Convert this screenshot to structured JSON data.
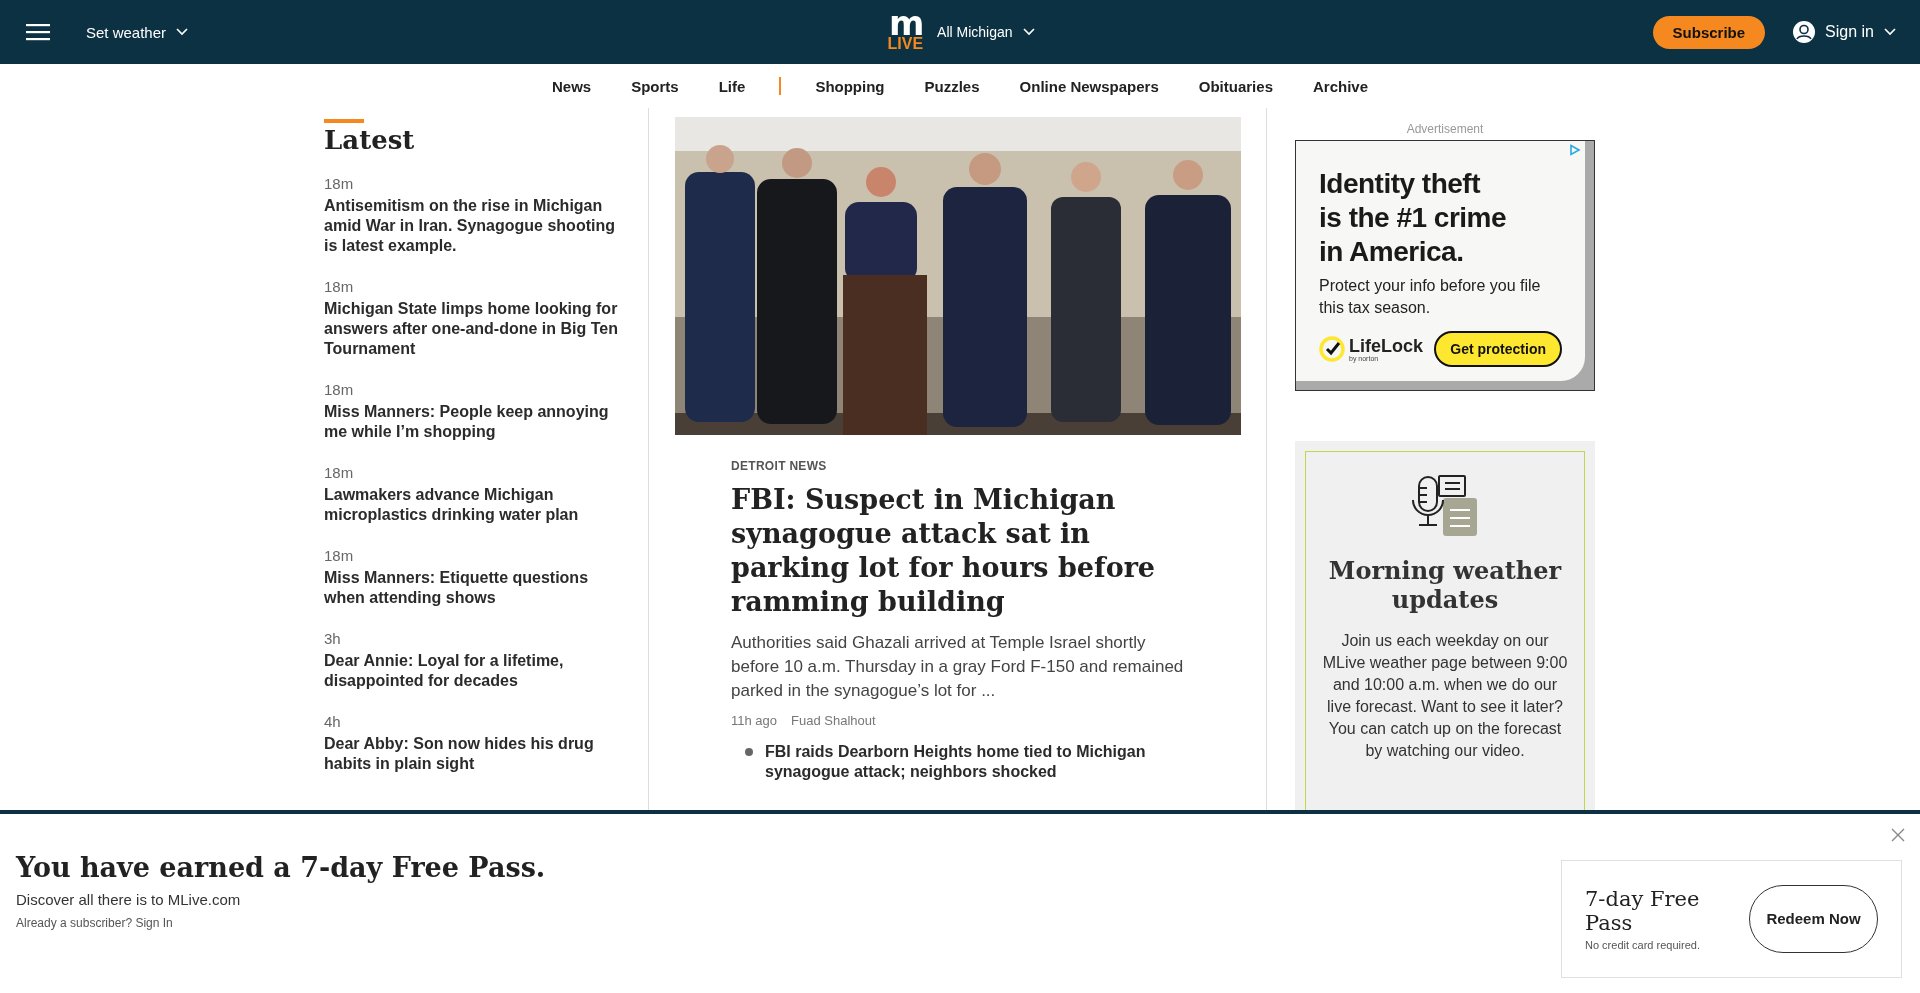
{
  "header": {
    "weather": "Set weather",
    "logo": {
      "top": "m",
      "bottom": "LIVE"
    },
    "region": "All Michigan",
    "subscribe": "Subscribe",
    "sign_in": "Sign in"
  },
  "nav": [
    {
      "label": "News",
      "kind": "link"
    },
    {
      "label": "Sports",
      "kind": "link"
    },
    {
      "label": "Life",
      "kind": "link"
    },
    {
      "kind": "divider"
    },
    {
      "label": "Shopping",
      "kind": "link"
    },
    {
      "label": "Puzzles",
      "kind": "link"
    },
    {
      "label": "Online Newspapers",
      "kind": "link"
    },
    {
      "label": "Obituaries",
      "kind": "link"
    },
    {
      "label": "Archive",
      "kind": "link"
    }
  ],
  "latest": {
    "title": "Latest",
    "items": [
      {
        "time": "18m",
        "title": "Antisemitism on the rise in Michigan amid War in Iran. Synagogue shooting is latest example."
      },
      {
        "time": "18m",
        "title": "Michigan State limps home looking for answers after one-and-done in Big Ten Tournament"
      },
      {
        "time": "18m",
        "title": "Miss Manners: People keep annoying me while I’m shopping"
      },
      {
        "time": "18m",
        "title": "Lawmakers advance Michigan microplastics drinking water plan"
      },
      {
        "time": "18m",
        "title": "Miss Manners: Etiquette questions when attending shows"
      },
      {
        "time": "3h",
        "title": "Dear Annie: Loyal for a lifetime, disappointed for decades"
      },
      {
        "time": "4h",
        "title": "Dear Abby: Son now hides his drug habits in plain sight"
      }
    ]
  },
  "lead_story": {
    "section": "DETROIT NEWS",
    "headline": "FBI: Suspect in Michigan synagogue attack sat in parking lot for hours before ramming building",
    "summary": "Authorities said Ghazali arrived at Temple Israel shortly before 10 a.m. Thursday in a gray Ford F-150 and remained parked in the synagogue’s lot for ...",
    "time": "11h ago",
    "author": "Fuad Shalhout",
    "related": [
      "FBI raids Dearborn Heights home tied to Michigan synagogue attack; neighbors shocked"
    ]
  },
  "advertisement": {
    "label": "Advertisement",
    "headline_lines": [
      "Identity theft",
      "is the #1 crime",
      "in America."
    ],
    "body": "Protect your info before you file this tax season.",
    "brand": "LifeLock",
    "brand_sub": "by norton",
    "button": "Get protection"
  },
  "promo": {
    "title": "Morning weather updates",
    "body": "Join us each weekday on our MLive weather page between 9:00 and 10:00 a.m. when we do our live forecast. Want to see it later? You can catch up on the forecast by watching our video."
  },
  "pass_banner": {
    "title": "You have earned a 7-day Free Pass.",
    "subtitle": "Discover all there is to MLive.com",
    "subscriber_text": "Already a subscriber?",
    "sign_in": "Sign In",
    "card_title": "7-day Free Pass",
    "card_note": "No credit card required.",
    "button": "Redeem Now"
  }
}
